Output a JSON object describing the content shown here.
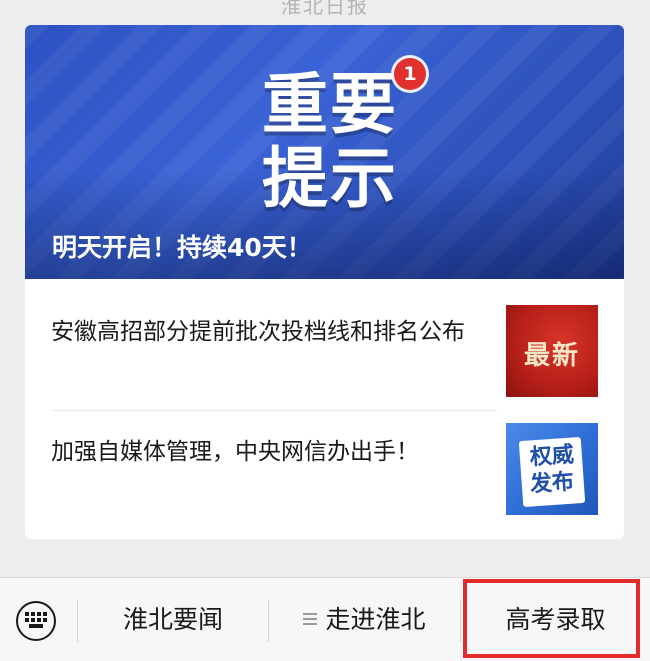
{
  "top_strip": {
    "text": "淮北日报"
  },
  "hero": {
    "big_line1": "重要",
    "big_line2": "提示",
    "badge": "1",
    "caption": "明天开启！持续40天！"
  },
  "articles": [
    {
      "title": "安徽高招部分提前批次投档线和排名公布",
      "thumb_text": "最新",
      "thumb_icon": "latest-news-thumbnail"
    },
    {
      "title": "加强自媒体管理，中央网信办出手！",
      "thumb_text_line1": "权威",
      "thumb_text_line2": "发布",
      "thumb_icon": "official-release-thumbnail"
    }
  ],
  "bottom_menu": {
    "keyboard_icon": "keyboard-icon",
    "items": [
      {
        "label": "淮北要闻"
      },
      {
        "label": "走进淮北",
        "icon": "menu-lines-icon"
      },
      {
        "label": "高考录取"
      }
    ]
  },
  "colors": {
    "hero_blue": "#2d51c2",
    "badge_red": "#e0312e",
    "thumb_red": "#b82019",
    "thumb_blue": "#2f6fd8",
    "highlight_red": "#e22b2b"
  }
}
